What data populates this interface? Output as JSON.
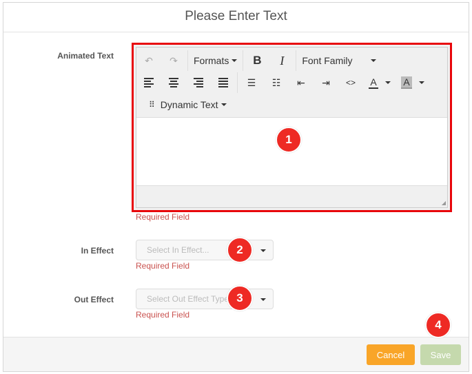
{
  "dialog": {
    "title": "Please Enter Text"
  },
  "fields": {
    "animated_text": {
      "label": "Animated Text",
      "error": "Required Field"
    },
    "in_effect": {
      "label": "In Effect",
      "placeholder": "Select In Effect...",
      "error": "Required Field"
    },
    "out_effect": {
      "label": "Out Effect",
      "placeholder": "Select Out Effect Type",
      "error": "Required Field"
    }
  },
  "toolbar": {
    "formats": "Formats",
    "bold": "B",
    "italic": "I",
    "font_family": "Font Family",
    "dynamic_text": "Dynamic Text",
    "code": "<>",
    "text_color": "A",
    "bg_color": "A"
  },
  "footer": {
    "cancel": "Cancel",
    "save": "Save"
  },
  "badges": [
    "1",
    "2",
    "3",
    "4"
  ],
  "colors": {
    "highlight": "#e8060b",
    "badge": "#ee2a24",
    "cancel": "#f9a528",
    "save": "#c5d9ad",
    "error": "#c9524f"
  }
}
